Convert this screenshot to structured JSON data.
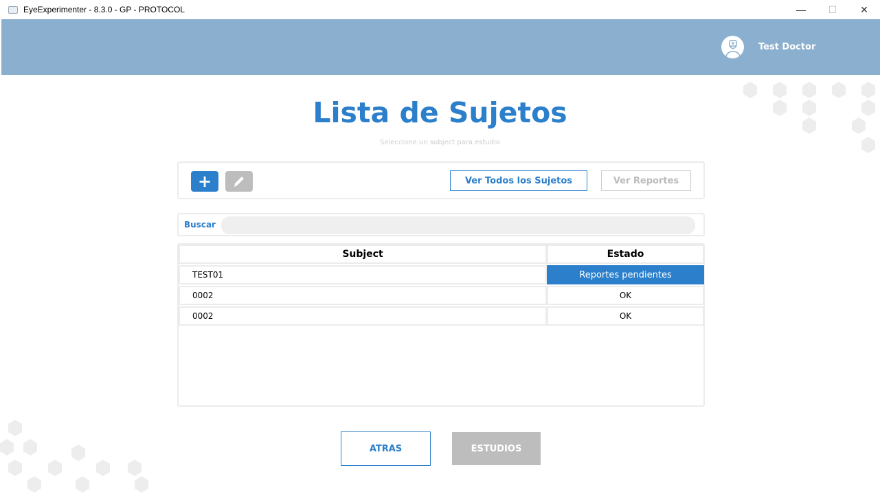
{
  "window": {
    "title": "EyeExperimenter - 8.3.0 - GP - PROTOCOL",
    "minimize": "—",
    "maximize": "☐",
    "close": "✕"
  },
  "header": {
    "user_name": "Test Doctor"
  },
  "page": {
    "title": "Lista de Sujetos",
    "subtitle": "Seleccione un subject para estudio"
  },
  "toolbar": {
    "add_label": "+",
    "view_all_label": "Ver Todos los Sujetos",
    "view_reports_label": "Ver Reportes"
  },
  "search": {
    "label": "Buscar",
    "value": ""
  },
  "table": {
    "columns": [
      "Subject",
      "Estado"
    ],
    "rows": [
      {
        "subject": "TEST01",
        "status": "Reportes pendientes"
      },
      {
        "subject": "0002",
        "status": "OK"
      },
      {
        "subject": "0002",
        "status": "OK"
      }
    ]
  },
  "footer": {
    "back_label": "ATRAS",
    "studies_label": "ESTUDIOS"
  },
  "colors": {
    "accent": "#2b7fcb",
    "header": "#8aafcf",
    "disabled": "#bdbdbd"
  }
}
